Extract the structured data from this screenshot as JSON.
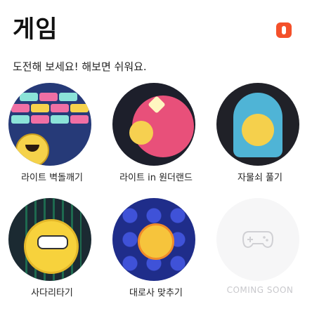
{
  "header": {
    "title": "게임",
    "subtitle": "도전해 보세요! 해보면 쉬워요.",
    "badge_icon": "badge-icon"
  },
  "games": [
    {
      "label": "라이트 벽돌깨기",
      "icon": "block-puzzle-thumbnail"
    },
    {
      "label": "라이트 in 원더랜드",
      "icon": "bomb-thumbnail"
    },
    {
      "label": "자물쇠 풀기",
      "icon": "keyhole-thumbnail"
    },
    {
      "label": "사다리타기",
      "icon": "ladder-thumbnail"
    },
    {
      "label": "대로사 맞추기",
      "icon": "dice-thumbnail"
    },
    {
      "label": "COMING SOON",
      "icon": "gamepad-icon"
    }
  ],
  "colors": {
    "badge": "#f4502a",
    "coming_soon_text": "#c8c8cc"
  }
}
